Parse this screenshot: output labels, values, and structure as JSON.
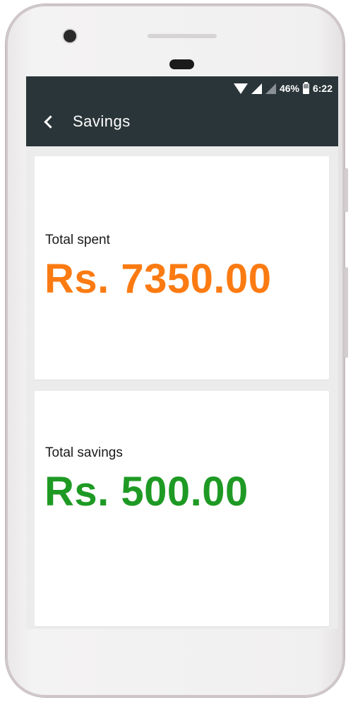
{
  "status_bar": {
    "battery_percent": "46%",
    "time": "6:22"
  },
  "app_bar": {
    "title": "Savings"
  },
  "cards": {
    "spent": {
      "label": "Total spent",
      "value": "Rs. 7350.00",
      "color": "#fb7b12"
    },
    "savings": {
      "label": "Total savings",
      "value": "Rs. 500.00",
      "color": "#1e9a24"
    }
  },
  "colors": {
    "app_bar_bg": "#2a3539",
    "screen_bg": "#ececec"
  },
  "icons": {
    "back": "chevron-left-icon",
    "wifi": "wifi-icon",
    "signal": "cell-signal-icon",
    "battery": "battery-icon"
  }
}
